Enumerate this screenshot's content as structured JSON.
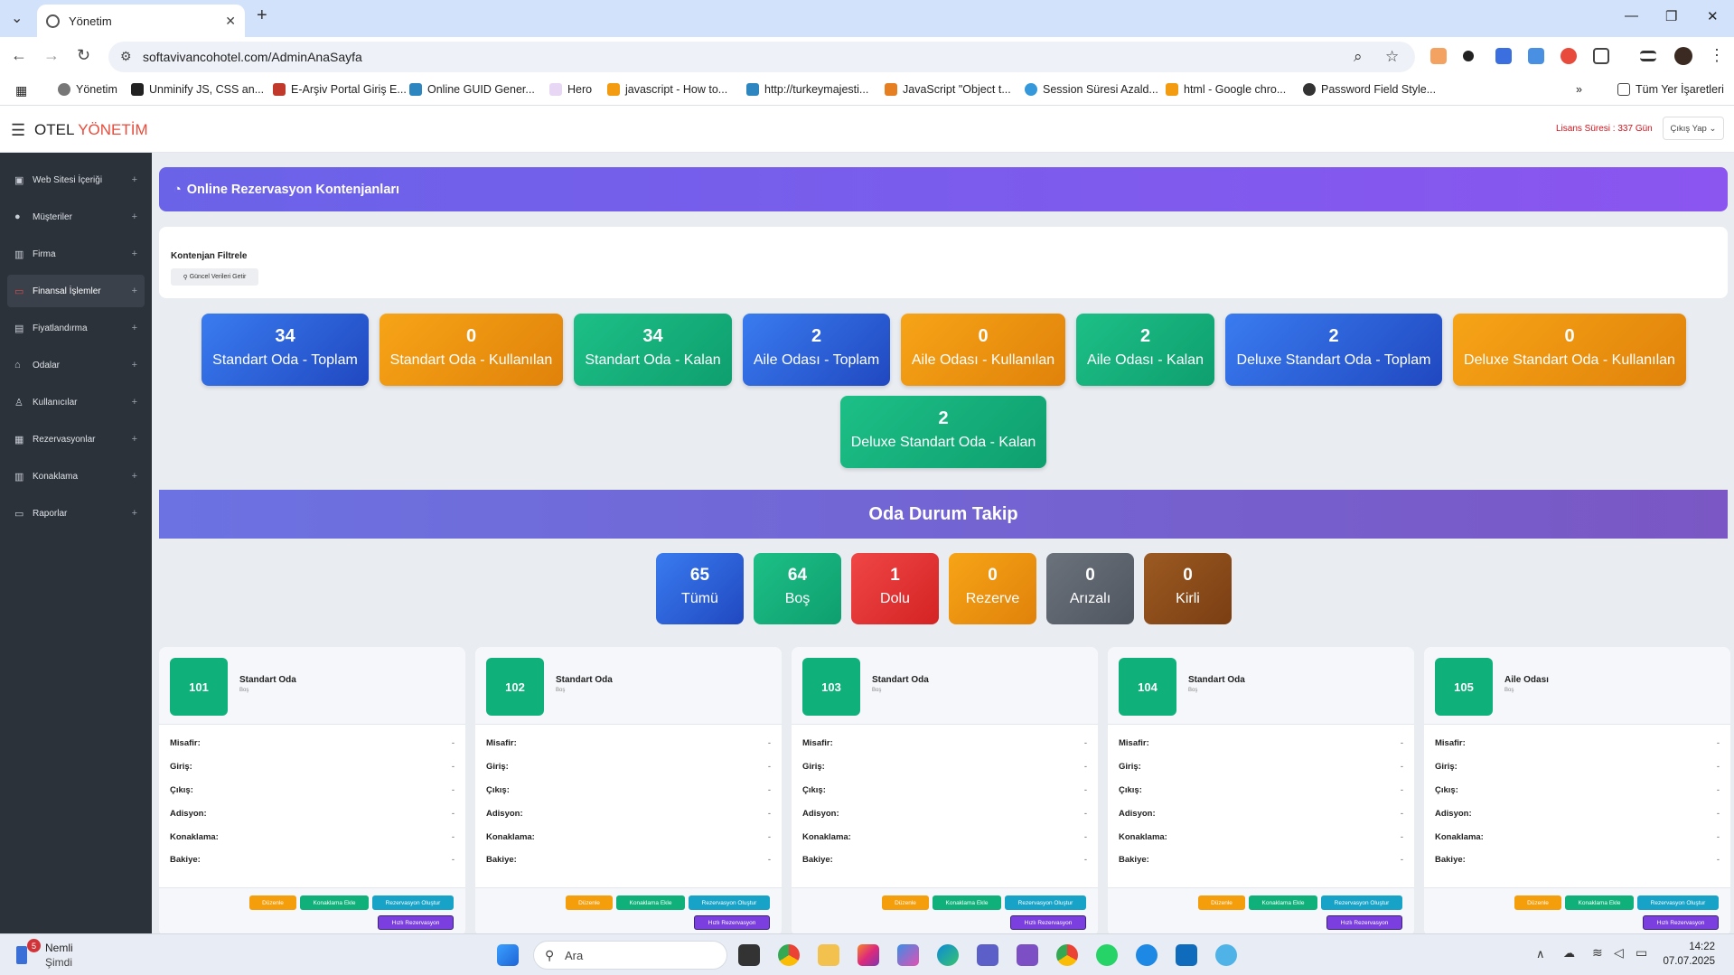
{
  "browser": {
    "tab_title": "Yönetim",
    "new_tab": "+",
    "url": "softavivancohotel.com/AdminAnaSayfa",
    "bookmarks": [
      "Yönetim",
      "Unminify JS, CSS an...",
      "E-Arşiv Portal Giriş E...",
      "Online GUID Gener...",
      "Hero",
      "javascript - How to...",
      "http://turkeymajesti...",
      "JavaScript \"Object t...",
      "Session Süresi Azald...",
      "html - Google chro...",
      "Password Field Style..."
    ],
    "all_bookmarks": "Tüm Yer İşaretleri"
  },
  "header": {
    "brand_prefix": "OTEL",
    "brand_suffix": "YÖNETİM",
    "license": "Lisans Süresi : 337 Gün",
    "logout": "Çıkış Yap"
  },
  "sidebar": {
    "items": [
      {
        "label": "Web Sitesi İçeriği",
        "icon": "image-icon"
      },
      {
        "label": "Müşteriler",
        "icon": "user-icon"
      },
      {
        "label": "Firma",
        "icon": "building-icon"
      },
      {
        "label": "Finansal İşlemler",
        "icon": "money-icon"
      },
      {
        "label": "Fiyatlandırma",
        "icon": "price-icon"
      },
      {
        "label": "Odalar",
        "icon": "home-icon"
      },
      {
        "label": "Kullanıcılar",
        "icon": "person-icon"
      },
      {
        "label": "Rezervasyonlar",
        "icon": "calendar-icon"
      },
      {
        "label": "Konaklama",
        "icon": "hotel-icon"
      },
      {
        "label": "Raporlar",
        "icon": "folder-icon"
      }
    ],
    "expand_symbol": "+"
  },
  "quota": {
    "title": "Online Rezervasyon Kontenjanları",
    "filter_title": "Kontenjan Filtrele",
    "filter_button": "Güncel Verileri Getir",
    "stats": [
      {
        "value": "34",
        "label": "Standart Oda - Toplam"
      },
      {
        "value": "0",
        "label": "Standart Oda - Kullanılan"
      },
      {
        "value": "34",
        "label": "Standart Oda - Kalan"
      },
      {
        "value": "2",
        "label": "Aile Odası - Toplam"
      },
      {
        "value": "0",
        "label": "Aile Odası - Kullanılan"
      },
      {
        "value": "2",
        "label": "Aile Odası - Kalan"
      },
      {
        "value": "2",
        "label": "Deluxe Standart Oda - Toplam"
      },
      {
        "value": "0",
        "label": "Deluxe Standart Oda - Kullanılan"
      },
      {
        "value": "2",
        "label": "Deluxe Standart Oda - Kalan"
      }
    ]
  },
  "room_status": {
    "title": "Oda Durum Takip",
    "stats": [
      {
        "value": "65",
        "label": "Tümü"
      },
      {
        "value": "64",
        "label": "Boş"
      },
      {
        "value": "1",
        "label": "Dolu"
      },
      {
        "value": "0",
        "label": "Rezerve"
      },
      {
        "value": "0",
        "label": "Arızalı"
      },
      {
        "value": "0",
        "label": "Kirli"
      }
    ]
  },
  "room_fields": [
    "Misafir:",
    "Giriş:",
    "Çıkış:",
    "Adisyon:",
    "Konaklama:",
    "Bakiye:"
  ],
  "room_empty_value": "-",
  "room_buttons": {
    "edit": "Düzenle",
    "add_stay": "Konaklama Ekle",
    "create_res": "Rezervasyon Oluştur",
    "quick_res": "Hızlı Rezervasyon"
  },
  "rooms": [
    {
      "number": "101",
      "type": "Standart Oda",
      "status": "Boş"
    },
    {
      "number": "102",
      "type": "Standart Oda",
      "status": "Boş"
    },
    {
      "number": "103",
      "type": "Standart Oda",
      "status": "Boş"
    },
    {
      "number": "104",
      "type": "Standart Oda",
      "status": "Boş"
    },
    {
      "number": "105",
      "type": "Aile Odası",
      "status": "Boş"
    }
  ],
  "taskbar": {
    "notification_count": "5",
    "notification_title": "Nemli",
    "notification_sub": "Şimdi",
    "search": "Ara",
    "time": "14:22",
    "date": "07.07.2025"
  }
}
